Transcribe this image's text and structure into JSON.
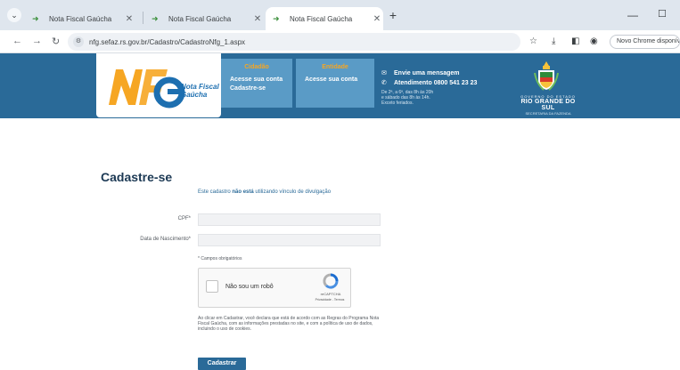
{
  "browser": {
    "tabs": [
      {
        "title": "Nota Fiscal Gaúcha",
        "active": false
      },
      {
        "title": "Nota Fiscal Gaúcha",
        "active": false
      },
      {
        "title": "Nota Fiscal Gaúcha",
        "active": true
      }
    ],
    "new_tab_glyph": "+",
    "url": "nfg.sefaz.rs.gov.br/Cadastro/CadastroNfg_1.aspx",
    "profile_label": "Novo Chrome disponível"
  },
  "header": {
    "logo_line1": "Nota Fiscal",
    "logo_line2": "Gaúcha",
    "cidadao": {
      "title": "Cidadão",
      "links": [
        "Acesse sua conta",
        "Cadastre-se"
      ]
    },
    "entidade": {
      "title": "Entidade",
      "links": [
        "Acesse sua conta"
      ]
    },
    "contact": {
      "message": "Envie uma mensagem",
      "phone": "Atendimento 0800 541 23 23",
      "hours": [
        "De 2ª, a 6ª, das 8h às 20h",
        "e sábado das 8h às 14h.",
        "Exceto feriados."
      ]
    },
    "government": {
      "line1": "GOVERNO DO ESTADO",
      "line2": "RIO GRANDE DO SUL",
      "line3": "SECRETARIA DA FAZENDA"
    }
  },
  "form": {
    "title": "Cadastre-se",
    "notice_prefix": "Este cadastro ",
    "notice_bold": "não está",
    "notice_suffix": " utilizando vínculo de divulgação",
    "cpf_label": "CPF*",
    "cpf_value": "",
    "birth_label": "Data de Nascimento*",
    "birth_value": "",
    "required_note": "* Campos obrigatórios",
    "captcha_label": "Não sou um robô",
    "captcha_brand": "reCAPTCHA",
    "captcha_terms": "Privacidade - Termos",
    "consent": "Ao clicar em Cadastrar, você declara que está de acordo com as Regras do Programa Nota Fiscal Gaúcha, com as informações prestadas no site, e com a política de uso de dados, incluindo o uso de cookies.",
    "submit_label": "Cadastrar"
  },
  "colors": {
    "header_bg": "#2a6a98",
    "box_bg": "#5a9bc6",
    "accent_orange": "#f6a623",
    "title_dark": "#1c3954"
  }
}
